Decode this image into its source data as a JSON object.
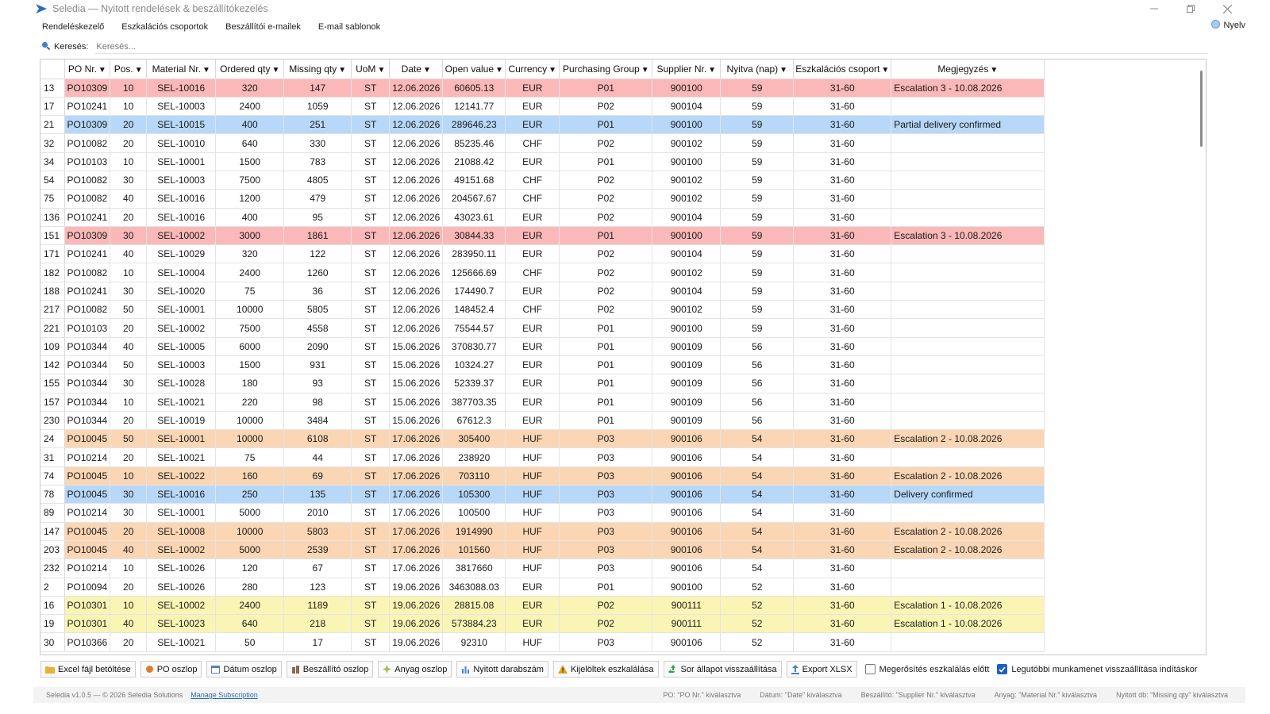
{
  "window": {
    "title": "Seledia — Nyitott rendelések & beszállítókezelés",
    "icon": "arrow-logo-icon",
    "accent": "#2a6cc4"
  },
  "tabs": [
    {
      "label": "Rendeléskezelő",
      "active": true
    },
    {
      "label": "Eszkalációs csoportok",
      "active": false
    },
    {
      "label": "Beszállítói e-mailek",
      "active": false
    },
    {
      "label": "E-mail sablonok",
      "active": false
    }
  ],
  "language_label": "Nyelv",
  "search": {
    "label": "Keresés:",
    "placeholder": "Keresés..."
  },
  "columns": [
    "PO Nr.",
    "Pos.",
    "Material Nr.",
    "Ordered qty",
    "Missing qty",
    "UoM",
    "Date",
    "Open value",
    "Currency",
    "Purchasing Group",
    "Supplier Nr.",
    "Nyitva (nap)",
    "Eszkalációs csoport",
    "Megjegyzés"
  ],
  "highlight_colors": {
    "red": "#fbb8b8",
    "blue": "#b7d8f8",
    "orange": "#fbd6b4",
    "yellow": "#fbf5b5"
  },
  "rows": [
    {
      "id": "13",
      "cells": [
        "PO10309",
        "10",
        "SEL-10016",
        "320",
        "147",
        "ST",
        "12.06.2026",
        "60605.13",
        "EUR",
        "P01",
        "900100",
        "59",
        "31-60",
        "Escalation 3 - 10.08.2026"
      ],
      "hl": "red"
    },
    {
      "id": "17",
      "cells": [
        "PO10241",
        "10",
        "SEL-10003",
        "2400",
        "1059",
        "ST",
        "12.06.2026",
        "12141.77",
        "EUR",
        "P02",
        "900104",
        "59",
        "31-60",
        ""
      ],
      "hl": ""
    },
    {
      "id": "21",
      "cells": [
        "PO10309",
        "20",
        "SEL-10015",
        "400",
        "251",
        "ST",
        "12.06.2026",
        "289646.23",
        "EUR",
        "P01",
        "900100",
        "59",
        "31-60",
        "Partial delivery confirmed"
      ],
      "hl": "blue"
    },
    {
      "id": "32",
      "cells": [
        "PO10082",
        "20",
        "SEL-10010",
        "640",
        "330",
        "ST",
        "12.06.2026",
        "85235.46",
        "CHF",
        "P02",
        "900102",
        "59",
        "31-60",
        ""
      ],
      "hl": ""
    },
    {
      "id": "34",
      "cells": [
        "PO10103",
        "10",
        "SEL-10001",
        "1500",
        "783",
        "ST",
        "12.06.2026",
        "21088.42",
        "EUR",
        "P01",
        "900100",
        "59",
        "31-60",
        ""
      ],
      "hl": ""
    },
    {
      "id": "54",
      "cells": [
        "PO10082",
        "30",
        "SEL-10003",
        "7500",
        "4805",
        "ST",
        "12.06.2026",
        "49151.68",
        "CHF",
        "P02",
        "900102",
        "59",
        "31-60",
        ""
      ],
      "hl": ""
    },
    {
      "id": "75",
      "cells": [
        "PO10082",
        "40",
        "SEL-10016",
        "1200",
        "479",
        "ST",
        "12.06.2026",
        "204567.67",
        "CHF",
        "P02",
        "900102",
        "59",
        "31-60",
        ""
      ],
      "hl": ""
    },
    {
      "id": "136",
      "cells": [
        "PO10241",
        "20",
        "SEL-10016",
        "400",
        "95",
        "ST",
        "12.06.2026",
        "43023.61",
        "EUR",
        "P02",
        "900104",
        "59",
        "31-60",
        ""
      ],
      "hl": ""
    },
    {
      "id": "151",
      "cells": [
        "PO10309",
        "30",
        "SEL-10002",
        "3000",
        "1861",
        "ST",
        "12.06.2026",
        "30844.33",
        "EUR",
        "P01",
        "900100",
        "59",
        "31-60",
        "Escalation 3 - 10.08.2026"
      ],
      "hl": "red"
    },
    {
      "id": "171",
      "cells": [
        "PO10241",
        "40",
        "SEL-10029",
        "320",
        "122",
        "ST",
        "12.06.2026",
        "283950.11",
        "EUR",
        "P02",
        "900104",
        "59",
        "31-60",
        ""
      ],
      "hl": ""
    },
    {
      "id": "182",
      "cells": [
        "PO10082",
        "10",
        "SEL-10004",
        "2400",
        "1260",
        "ST",
        "12.06.2026",
        "125666.69",
        "CHF",
        "P02",
        "900102",
        "59",
        "31-60",
        ""
      ],
      "hl": ""
    },
    {
      "id": "188",
      "cells": [
        "PO10241",
        "30",
        "SEL-10020",
        "75",
        "36",
        "ST",
        "12.06.2026",
        "174490.7",
        "EUR",
        "P02",
        "900104",
        "59",
        "31-60",
        ""
      ],
      "hl": ""
    },
    {
      "id": "217",
      "cells": [
        "PO10082",
        "50",
        "SEL-10001",
        "10000",
        "5805",
        "ST",
        "12.06.2026",
        "148452.4",
        "CHF",
        "P02",
        "900102",
        "59",
        "31-60",
        ""
      ],
      "hl": ""
    },
    {
      "id": "221",
      "cells": [
        "PO10103",
        "20",
        "SEL-10002",
        "7500",
        "4558",
        "ST",
        "12.06.2026",
        "75544.57",
        "EUR",
        "P01",
        "900100",
        "59",
        "31-60",
        ""
      ],
      "hl": ""
    },
    {
      "id": "109",
      "cells": [
        "PO10344",
        "40",
        "SEL-10005",
        "6000",
        "2090",
        "ST",
        "15.06.2026",
        "370830.77",
        "EUR",
        "P01",
        "900109",
        "56",
        "31-60",
        ""
      ],
      "hl": ""
    },
    {
      "id": "142",
      "cells": [
        "PO10344",
        "50",
        "SEL-10003",
        "1500",
        "931",
        "ST",
        "15.06.2026",
        "10324.27",
        "EUR",
        "P01",
        "900109",
        "56",
        "31-60",
        ""
      ],
      "hl": ""
    },
    {
      "id": "155",
      "cells": [
        "PO10344",
        "30",
        "SEL-10028",
        "180",
        "93",
        "ST",
        "15.06.2026",
        "52339.37",
        "EUR",
        "P01",
        "900109",
        "56",
        "31-60",
        ""
      ],
      "hl": ""
    },
    {
      "id": "157",
      "cells": [
        "PO10344",
        "10",
        "SEL-10021",
        "220",
        "98",
        "ST",
        "15.06.2026",
        "387703.35",
        "EUR",
        "P01",
        "900109",
        "56",
        "31-60",
        ""
      ],
      "hl": ""
    },
    {
      "id": "230",
      "cells": [
        "PO10344",
        "20",
        "SEL-10019",
        "10000",
        "3484",
        "ST",
        "15.06.2026",
        "67612.3",
        "EUR",
        "P01",
        "900109",
        "56",
        "31-60",
        ""
      ],
      "hl": ""
    },
    {
      "id": "24",
      "cells": [
        "PO10045",
        "50",
        "SEL-10001",
        "10000",
        "6108",
        "ST",
        "17.06.2026",
        "305400",
        "HUF",
        "P03",
        "900106",
        "54",
        "31-60",
        "Escalation 2 - 10.08.2026"
      ],
      "hl": "orange"
    },
    {
      "id": "31",
      "cells": [
        "PO10214",
        "20",
        "SEL-10021",
        "75",
        "44",
        "ST",
        "17.06.2026",
        "238920",
        "HUF",
        "P03",
        "900106",
        "54",
        "31-60",
        ""
      ],
      "hl": ""
    },
    {
      "id": "74",
      "cells": [
        "PO10045",
        "10",
        "SEL-10022",
        "160",
        "69",
        "ST",
        "17.06.2026",
        "703110",
        "HUF",
        "P03",
        "900106",
        "54",
        "31-60",
        "Escalation 2 - 10.08.2026"
      ],
      "hl": "orange"
    },
    {
      "id": "78",
      "cells": [
        "PO10045",
        "30",
        "SEL-10016",
        "250",
        "135",
        "ST",
        "17.06.2026",
        "105300",
        "HUF",
        "P03",
        "900106",
        "54",
        "31-60",
        "Delivery confirmed"
      ],
      "hl": "blue"
    },
    {
      "id": "89",
      "cells": [
        "PO10214",
        "30",
        "SEL-10001",
        "5000",
        "2010",
        "ST",
        "17.06.2026",
        "100500",
        "HUF",
        "P03",
        "900106",
        "54",
        "31-60",
        ""
      ],
      "hl": ""
    },
    {
      "id": "147",
      "cells": [
        "PO10045",
        "20",
        "SEL-10008",
        "10000",
        "5803",
        "ST",
        "17.06.2026",
        "1914990",
        "HUF",
        "P03",
        "900106",
        "54",
        "31-60",
        "Escalation 2 - 10.08.2026"
      ],
      "hl": "orange"
    },
    {
      "id": "203",
      "cells": [
        "PO10045",
        "40",
        "SEL-10002",
        "5000",
        "2539",
        "ST",
        "17.06.2026",
        "101560",
        "HUF",
        "P03",
        "900106",
        "54",
        "31-60",
        "Escalation 2 - 10.08.2026"
      ],
      "hl": "orange"
    },
    {
      "id": "232",
      "cells": [
        "PO10214",
        "10",
        "SEL-10026",
        "120",
        "67",
        "ST",
        "17.06.2026",
        "3817660",
        "HUF",
        "P03",
        "900106",
        "54",
        "31-60",
        ""
      ],
      "hl": ""
    },
    {
      "id": "2",
      "cells": [
        "PO10094",
        "20",
        "SEL-10026",
        "280",
        "123",
        "ST",
        "19.06.2026",
        "3463088.03",
        "EUR",
        "P01",
        "900100",
        "52",
        "31-60",
        ""
      ],
      "hl": ""
    },
    {
      "id": "16",
      "cells": [
        "PO10301",
        "10",
        "SEL-10002",
        "2400",
        "1189",
        "ST",
        "19.06.2026",
        "28815.08",
        "EUR",
        "P02",
        "900111",
        "52",
        "31-60",
        "Escalation 1 - 10.08.2026"
      ],
      "hl": "yellow"
    },
    {
      "id": "19",
      "cells": [
        "PO10301",
        "40",
        "SEL-10023",
        "640",
        "218",
        "ST",
        "19.06.2026",
        "573884.23",
        "EUR",
        "P02",
        "900111",
        "52",
        "31-60",
        "Escalation 1 - 10.08.2026"
      ],
      "hl": "yellow"
    },
    {
      "id": "30",
      "cells": [
        "PO10366",
        "20",
        "SEL-10021",
        "50",
        "17",
        "ST",
        "19.06.2026",
        "92310",
        "HUF",
        "P03",
        "900106",
        "52",
        "31-60",
        ""
      ],
      "hl": ""
    }
  ],
  "toolbar": {
    "buttons": [
      {
        "label": "Excel fájl betöltése",
        "icon": "folder-icon",
        "color": "#e8b23a"
      },
      {
        "label": "PO oszlop",
        "icon": "po-icon",
        "color": "#e07b2a"
      },
      {
        "label": "Dátum oszlop",
        "icon": "calendar-icon",
        "color": "#5a7fb0"
      },
      {
        "label": "Beszállító oszlop",
        "icon": "supplier-icon",
        "color": "#8a6a4a"
      },
      {
        "label": "Anyag oszlop",
        "icon": "material-icon",
        "color": "#a0c040"
      },
      {
        "label": "Nyitott darabszám",
        "icon": "chart-icon",
        "color": "#4a80c8"
      },
      {
        "label": "Kijelöltek eszkalálása",
        "icon": "warning-icon",
        "color": "#e8a020"
      },
      {
        "label": "Sor állapot visszaállítása",
        "icon": "recycle-icon",
        "color": "#3aa050"
      },
      {
        "label": "Export XLSX",
        "icon": "export-icon",
        "color": "#4a80c8"
      }
    ],
    "checkboxes": [
      {
        "label": "Megerősítés eszkalálás előtt",
        "checked": false
      },
      {
        "label": "Legutóbbi munkamenet visszaállítása indításkor",
        "checked": true
      }
    ]
  },
  "status": {
    "version": "Seledia v1.0.5 — © 2026 Seledia Solutions",
    "link": "Manage Subscription",
    "items": [
      "PO: \"PO Nr.\" kiválasztva",
      "Dátum: \"Date\" kiválasztva",
      "Beszállító: \"Supplier Nr.\" kiválasztva",
      "Anyag: \"Material Nr.\" kiválasztva",
      "Nyitott db: \"Missing qty\" kiválasztva"
    ]
  }
}
